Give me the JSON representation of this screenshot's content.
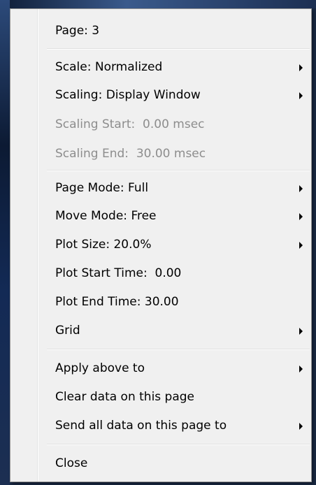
{
  "menu": {
    "page": "Page: 3",
    "scale": "Scale: Normalized",
    "scaling": "Scaling: Display Window",
    "scaling_start": "Scaling Start:  0.00 msec",
    "scaling_end": "Scaling End:  30.00 msec",
    "page_mode": "Page Mode: Full",
    "move_mode": "Move Mode: Free",
    "plot_size": "Plot Size: 20.0%",
    "plot_start_time": "Plot Start Time:  0.00",
    "plot_end_time": "Plot End Time: 30.00",
    "grid": "Grid",
    "apply_above": "Apply above to",
    "clear_data": "Clear data on this page",
    "send_all_data": "Send all data on this page to",
    "close": "Close"
  },
  "icons": {
    "submenu": "chevron-right-icon"
  }
}
